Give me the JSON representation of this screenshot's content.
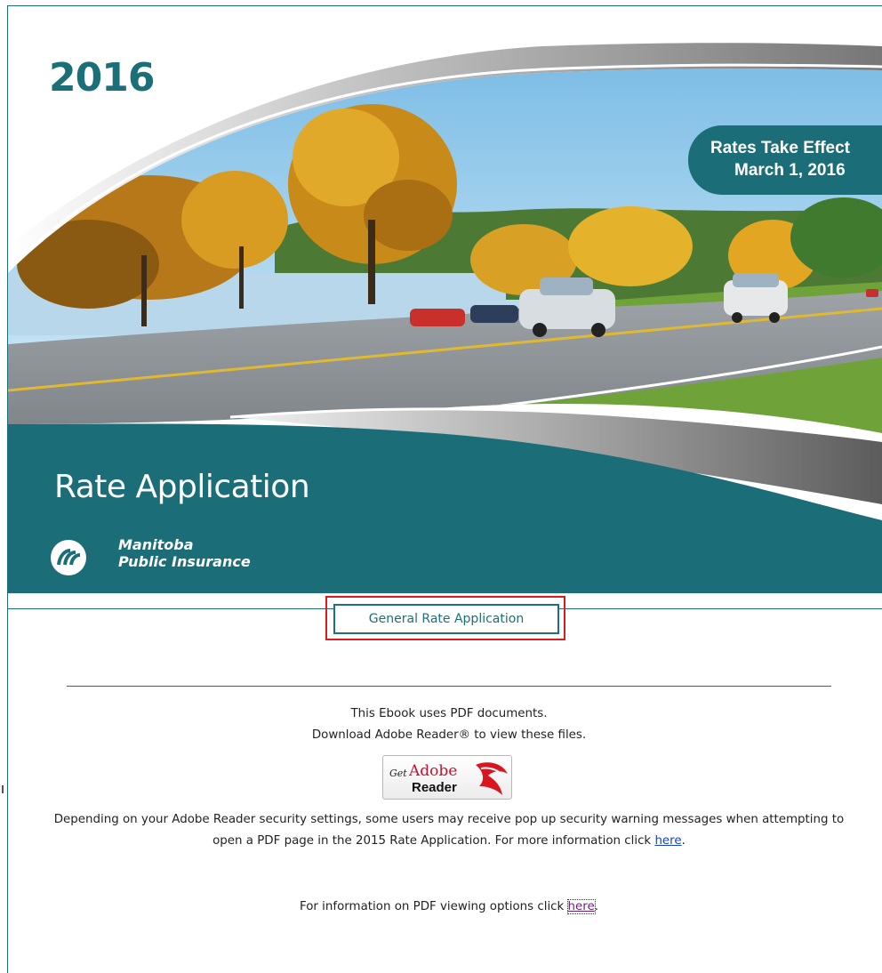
{
  "hero": {
    "year": "2016",
    "badge_line1": "Rates Take Effect",
    "badge_line2": "March 1, 2016",
    "title": "Rate Application",
    "logo_line1": "Manitoba",
    "logo_line2": "Public Insurance",
    "colors": {
      "teal": "#1b6e78",
      "sky": "#9fd0ec",
      "autumn": "#e3a21b"
    }
  },
  "main": {
    "gra_button_label": "General Rate Application",
    "highlight_color": "#e01a1a",
    "pdf_notice_line1": "This Ebook uses PDF documents.",
    "pdf_notice_line2": "Download Adobe Reader® to view these files.",
    "adobe_badge": {
      "get": "Get",
      "brand": "Adobe",
      "reader": "Reader"
    },
    "security_text_before": "Depending on your Adobe Reader security settings, some users may receive pop up security warning messages when attempting to open a PDF page in the 2015 Rate Application. For more information click ",
    "security_link": "here",
    "security_text_after": ".",
    "viewing_text_before": "For information on PDF viewing options click ",
    "viewing_link": "here",
    "viewing_text_after": "."
  }
}
